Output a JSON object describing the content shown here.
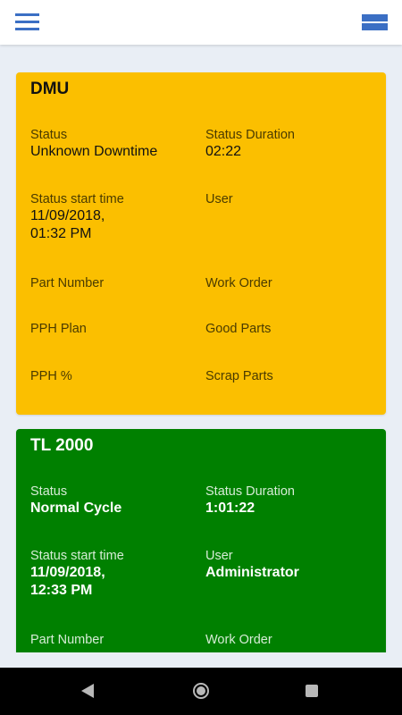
{
  "colors": {
    "accent": "#3b6fc4",
    "downtime_card": "#fbbf00",
    "running_card": "#008000",
    "background": "#e9eef5"
  },
  "icons": {
    "menu": "hamburger-menu-icon",
    "view_toggle": "view-toggle-icon",
    "back": "back-icon",
    "home": "home-icon",
    "recent": "recent-apps-icon"
  },
  "machines": [
    {
      "name": "DMU",
      "status_label": "Status",
      "status_value": "Unknown Downtime",
      "duration_label": "Status Duration",
      "duration_value": "02:22",
      "start_label": "Status start time",
      "start_value_line1": "11/09/2018,",
      "start_value_line2": "01:32 PM",
      "user_label": "User",
      "user_value": "",
      "part_label": "Part Number",
      "workorder_label": "Work Order",
      "pph_plan_label": "PPH Plan",
      "good_parts_label": "Good Parts",
      "pph_pct_label": "PPH %",
      "scrap_parts_label": "Scrap Parts"
    },
    {
      "name": "TL 2000",
      "status_label": "Status",
      "status_value": "Normal Cycle",
      "duration_label": "Status Duration",
      "duration_value": "1:01:22",
      "start_label": "Status start time",
      "start_value_line1": "11/09/2018,",
      "start_value_line2": "12:33 PM",
      "user_label": "User",
      "user_value": "Administrator",
      "part_label": "Part Number",
      "workorder_label": "Work Order"
    }
  ]
}
